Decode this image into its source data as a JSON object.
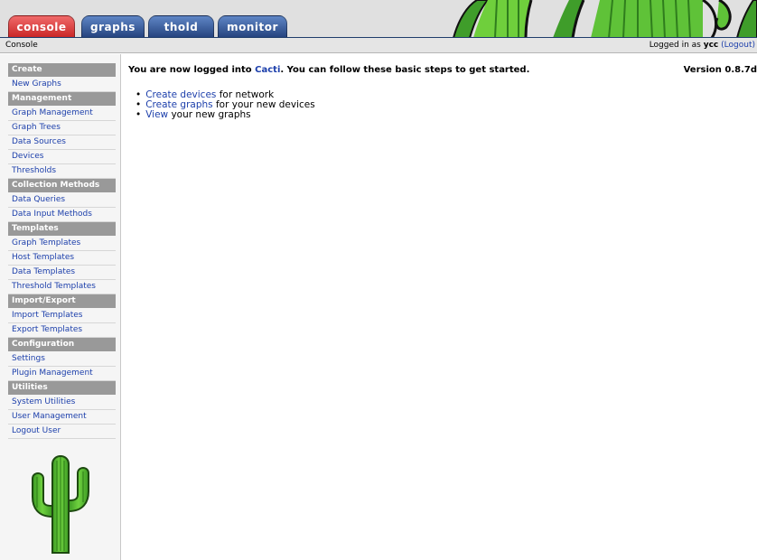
{
  "tabs": [
    {
      "label": "console",
      "active": true
    },
    {
      "label": "graphs",
      "active": false
    },
    {
      "label": "thold",
      "active": false
    },
    {
      "label": "monitor",
      "active": false
    }
  ],
  "breadcrumb": "Console",
  "login": {
    "prefix": "Logged in as",
    "user": "ycc",
    "logout_label": "(Logout)"
  },
  "sidebar": {
    "sections": [
      {
        "header": "Create",
        "items": [
          "New Graphs"
        ]
      },
      {
        "header": "Management",
        "items": [
          "Graph Management",
          "Graph Trees",
          "Data Sources",
          "Devices",
          "Thresholds"
        ]
      },
      {
        "header": "Collection Methods",
        "items": [
          "Data Queries",
          "Data Input Methods"
        ]
      },
      {
        "header": "Templates",
        "items": [
          "Graph Templates",
          "Host Templates",
          "Data Templates",
          "Threshold Templates"
        ]
      },
      {
        "header": "Import/Export",
        "items": [
          "Import Templates",
          "Export Templates"
        ]
      },
      {
        "header": "Configuration",
        "items": [
          "Settings",
          "Plugin Management"
        ]
      },
      {
        "header": "Utilities",
        "items": [
          "System Utilities",
          "User Management",
          "Logout User"
        ]
      }
    ]
  },
  "main": {
    "welcome_prefix": "You are now logged into",
    "welcome_link": "Cacti",
    "welcome_suffix": ". You can follow these basic steps to get started.",
    "version": "Version 0.8.7d",
    "steps": [
      {
        "link": "Create devices",
        "text": " for network"
      },
      {
        "link": "Create graphs",
        "text": " for your new devices"
      },
      {
        "link": "View",
        "text": " your new graphs"
      }
    ]
  },
  "colors": {
    "link": "#1c3fab",
    "menu_header": "#999999",
    "active_tab": "#c82424",
    "tab": "#23417c"
  },
  "icons": {
    "logo": "cactus-logo-icon",
    "banner": "cactus-banner-icon"
  }
}
